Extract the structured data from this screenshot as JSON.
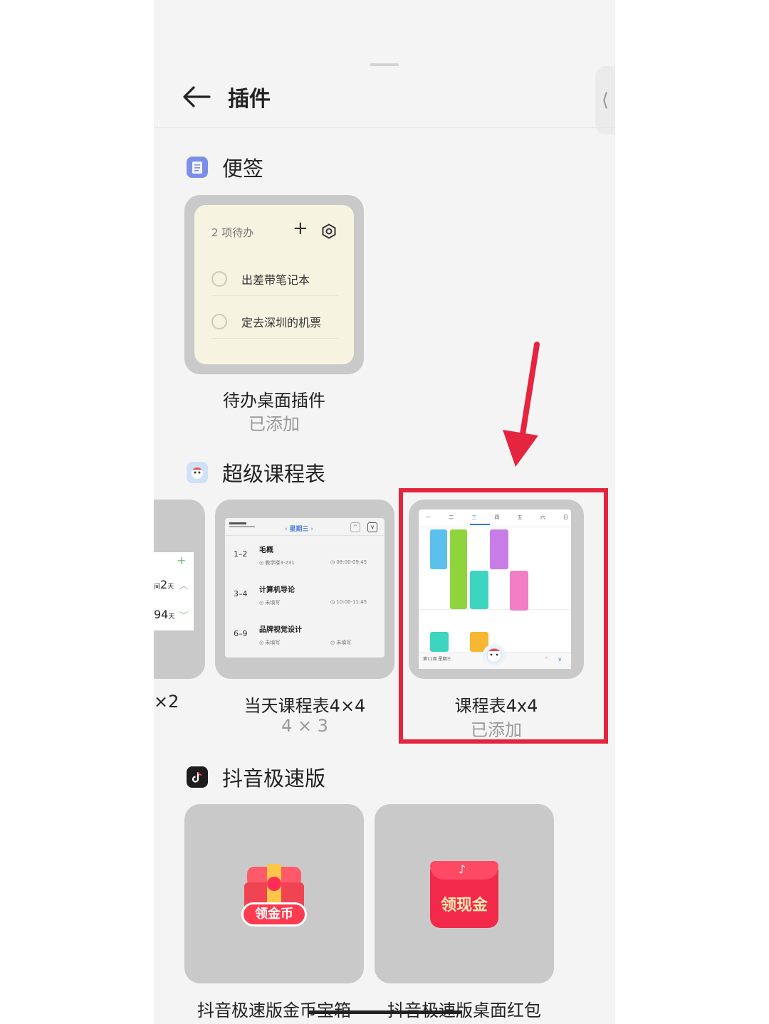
{
  "header": {
    "title": "插件"
  },
  "sections": [
    {
      "title": "便签",
      "widgets": [
        {
          "name": "待办桌面插件",
          "status": "已添加",
          "preview": {
            "count_text": "2 项待办",
            "plus": "+",
            "items": [
              "出差带笔记本",
              "定去深圳的机票"
            ]
          }
        }
      ]
    },
    {
      "title": "超级课程表",
      "widgets": [
        {
          "name_partial": "×2",
          "preview": {
            "plus": "+",
            "row1": "2",
            "row1_unit": "天",
            "row2": "94",
            "row2_unit": "天"
          }
        },
        {
          "name": "当天课程表4×4",
          "status": "4 × 3",
          "preview": {
            "weekday": "星期三",
            "rows": [
              {
                "period": "1–2",
                "course": "毛概",
                "room": "教学楼3-231",
                "time": "08:00-09:45"
              },
              {
                "period": "3–4",
                "course": "计算机导论",
                "room": "未填写",
                "time": "10:00-11:45"
              },
              {
                "period": "6–9",
                "course": "品牌视觉设计",
                "room": "未填写",
                "time": "未填写"
              }
            ]
          }
        },
        {
          "name": "课程表4x4",
          "status": "已添加",
          "preview": {
            "days": [
              "一",
              "二",
              "三",
              "四",
              "五",
              "六",
              "日"
            ],
            "week_text": "第11周 星期三"
          }
        }
      ]
    },
    {
      "title": "抖音极速版",
      "widgets": [
        {
          "name": "抖音极速版金币宝箱",
          "button_text": "领金币"
        },
        {
          "name": "抖音极速版桌面红包",
          "button_text": "领现金"
        }
      ]
    }
  ],
  "colors": {
    "highlight": "#e5253f",
    "panel_bg": "#f4f4f4",
    "card_bg": "#c9c9c9"
  }
}
